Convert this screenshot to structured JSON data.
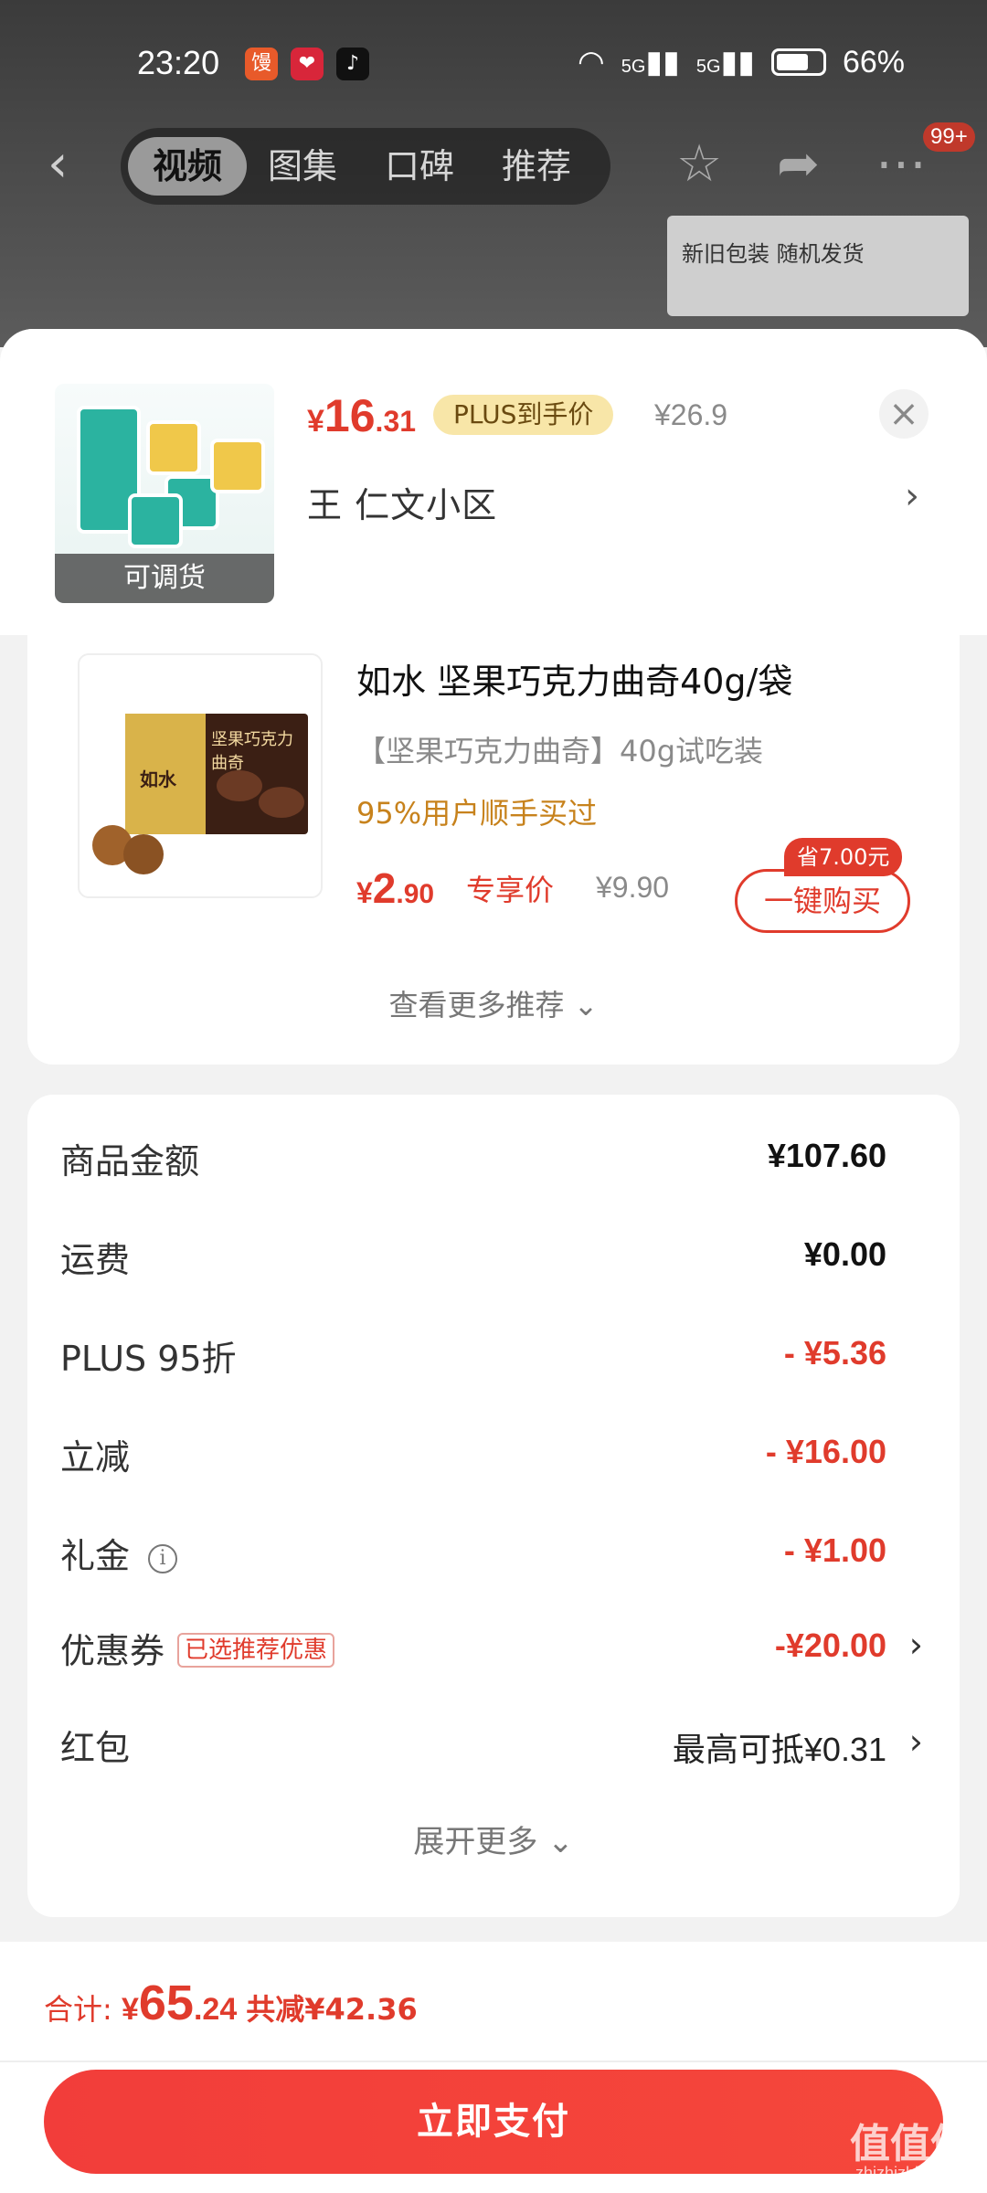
{
  "status_bar": {
    "time": "23:20",
    "battery": "66%",
    "signal_1": "5G",
    "signal_2": "5G"
  },
  "nav": {
    "tabs": [
      "视频",
      "图集",
      "口碑",
      "推荐"
    ],
    "badge": "99+"
  },
  "background": {
    "thumb_text": "新旧包装 随机发货"
  },
  "product": {
    "price_symbol": "¥",
    "price_int": "16",
    "price_dec": ".31",
    "plus_tag": "PLUS到手价",
    "original_price": "¥26.9",
    "address": "王  仁文小区",
    "image_overlay": "可调货"
  },
  "recommendation": {
    "name": "如水 坚果巧克力曲奇40g/袋",
    "desc": "【坚果巧克力曲奇】40g试吃装",
    "stat": "95%用户顺手买过",
    "price_symbol": "¥",
    "price_int": "2",
    "price_dec": ".90",
    "exclusive_label": "专享价",
    "original_price": "¥9.90",
    "save_tag": "省7.00元",
    "buy_label": "一键购买",
    "more_label": "查看更多推荐 ⌄",
    "package_brand": "如水",
    "package_title": "坚果巧克力曲奇"
  },
  "summary": {
    "rows": [
      {
        "label": "商品金额",
        "value": "¥107.60"
      },
      {
        "label": "运费",
        "value": "¥0.00"
      },
      {
        "label": "PLUS 95折",
        "value": "- ¥5.36"
      },
      {
        "label": "立减",
        "value": "- ¥16.00"
      },
      {
        "label": "礼金",
        "value": "- ¥1.00"
      },
      {
        "label": "优惠券",
        "value": "-¥20.00",
        "tag": "已选推荐优惠"
      },
      {
        "label": "红包",
        "value": "最高可抵¥0.31"
      }
    ],
    "expand_label": "展开更多 ⌄"
  },
  "footer": {
    "total_label": "合计: ",
    "total_symbol": "¥",
    "total_int": "65",
    "total_dec": ".24",
    "saved": "共减¥42.36",
    "pay_label": "立即支付"
  },
  "watermark": {
    "main": "值值值",
    "sub": "zhizhizhi.com"
  },
  "colors": {
    "accent": "#e03b2c",
    "plus_tag_bg": "#f8e6a8",
    "stat": "#c7821c"
  }
}
